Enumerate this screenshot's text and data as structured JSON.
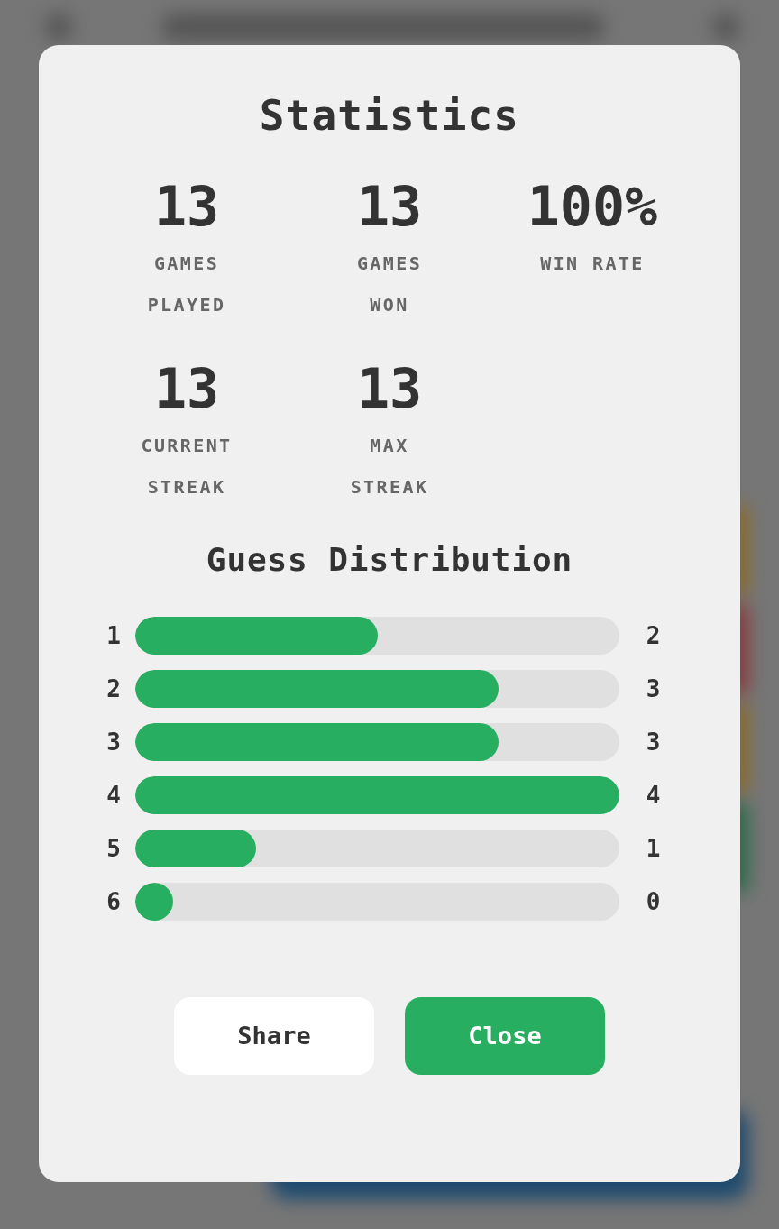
{
  "title": "Statistics",
  "stats": [
    {
      "value": "13",
      "label": "GAMES PLAYED"
    },
    {
      "value": "13",
      "label": "GAMES WON"
    },
    {
      "value": "100%",
      "label": "WIN RATE"
    },
    {
      "value": "13",
      "label": "CURRENT STREAK"
    },
    {
      "value": "13",
      "label": "MAX STREAK"
    }
  ],
  "distribution": {
    "title": "Guess Distribution",
    "rows": [
      {
        "guess": "1",
        "count": "2",
        "level": 0.5
      },
      {
        "guess": "2",
        "count": "3",
        "level": 0.75
      },
      {
        "guess": "3",
        "count": "3",
        "level": 0.75
      },
      {
        "guess": "4",
        "count": "4",
        "level": 1
      },
      {
        "guess": "5",
        "count": "1",
        "level": 0.25
      },
      {
        "guess": "6",
        "count": "0",
        "level": 0
      }
    ]
  },
  "buttons": [
    {
      "label": "Share",
      "kind": "secondary"
    },
    {
      "label": "Close",
      "kind": "primary"
    }
  ]
}
